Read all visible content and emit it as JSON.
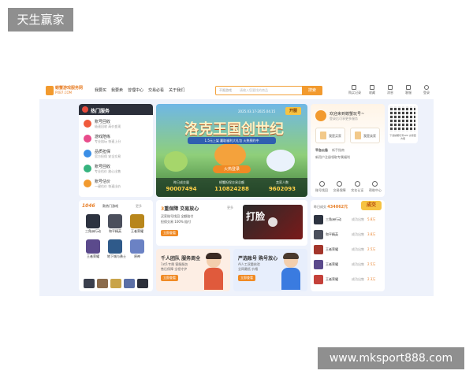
{
  "watermarks": {
    "top_left": "天生赢家",
    "bottom_right": "www.mksport888.com"
  },
  "header": {
    "logo": "螃蟹游戏服务网",
    "logo_sub": "PXB7.COM",
    "nav": [
      "我要买",
      "我要卖",
      "曾理中心",
      "交易必看",
      "关于我们"
    ],
    "search": {
      "category": "不限游戏",
      "placeholder": "请输入您要找的商品",
      "button": "搜索"
    },
    "icons": [
      {
        "name": "cart-icon",
        "label": "购买记录"
      },
      {
        "name": "star-icon",
        "label": "收藏"
      },
      {
        "name": "bell-icon",
        "label": "消息"
      },
      {
        "name": "clock-icon",
        "label": "客服"
      },
      {
        "name": "user-icon",
        "label": "登录"
      }
    ]
  },
  "hot_services": {
    "title": "热门服务",
    "items": [
      {
        "name": "账号回收",
        "desc": "极速回收 高价变现",
        "color": "#f05a3c"
      },
      {
        "name": "游戏陪练",
        "desc": "专业陪玩 快速上分",
        "color": "#e84c8b"
      },
      {
        "name": "品质担保",
        "desc": "官方担保 安全交易",
        "color": "#3a8ee6"
      },
      {
        "name": "账号回收",
        "desc": "专业估价 放心出售",
        "color": "#36b37e"
      },
      {
        "name": "账号估价",
        "desc": "一键估价 快速出价",
        "color": "#f29a2e"
      }
    ]
  },
  "banner": {
    "title": "洛克王国创世纪",
    "subtitle": "1.5元上架 赢取福利大礼包 火热预约中",
    "date": "2025.03.17-2025.04.15",
    "badge": "开服",
    "cta": "火热登录",
    "stats": [
      {
        "label": "昨日成交量",
        "value": "90007494"
      },
      {
        "label": "螃蟹担保交易总额",
        "value": "110824288"
      },
      {
        "label": "卖家人数",
        "value": "9602093"
      }
    ]
  },
  "user_panel": {
    "welcome": "欢迎来到螃蟹玩号~",
    "sub": "登录后可享更多服务",
    "buttons": [
      "我是买家",
      "我是卖家"
    ],
    "tabs": [
      "平台公告",
      "新手指南"
    ],
    "notice": "新用户注册领取专属福利",
    "quick": [
      "账号找回",
      "交易保障",
      "实名认证",
      "帮助中心"
    ]
  },
  "qr": {
    "caption": "下载螃蟹玩号APP 交易更方便"
  },
  "games": {
    "badge": "1046",
    "title": "款热门游戏",
    "more": "更多",
    "items": [
      {
        "name": "三角洲行动",
        "color": "#2d3340"
      },
      {
        "name": "和平精英",
        "color": "#4b4f5c"
      },
      {
        "name": "王者荣耀",
        "color": "#b8861b"
      },
      {
        "name": "王者荣耀",
        "color": "#5b4a8c"
      },
      {
        "name": "地下城与勇士",
        "color": "#2f5a8a"
      },
      {
        "name": "原神",
        "color": "#6b82c4"
      }
    ]
  },
  "service": {
    "title_num": "3",
    "title": "重保障 交易放心",
    "more": "更多",
    "line1": "买家账号找回 全额赔付",
    "line2": "担保交易 100% 赔付",
    "button": "立即查看",
    "thumb": "打脸"
  },
  "promos": [
    {
      "title": "千人团队 服务周全",
      "a": "1对1专属 客服服务",
      "b": "售后保障 全程守护",
      "button": "立即查看",
      "hair": "#3a2a24",
      "body": "#e05a3c",
      "bg": "#fdeee4"
    },
    {
      "title": "严选账号 购号放心",
      "a": "AI人工双重核验",
      "b": "全网最低 价格",
      "button": "立即查看",
      "hair": "#4a3a2e",
      "body": "#3a7be0",
      "bg": "#e7eefc"
    }
  ],
  "trades": {
    "label": "昨日成交",
    "amount": "434062元",
    "flag": "成交",
    "rows": [
      {
        "name": "三角洲行动",
        "status": "成功出售",
        "amount": "5.8万",
        "color": "#2d3340"
      },
      {
        "name": "和平精英",
        "status": "成功出售",
        "amount": "3.8万",
        "color": "#4b4f5c"
      },
      {
        "name": "王者荣耀",
        "status": "成功出售",
        "amount": "2.5万",
        "color": "#a3362b"
      },
      {
        "name": "王者荣耀",
        "status": "成功出售",
        "amount": "2.5万",
        "color": "#5b4a8c"
      },
      {
        "name": "王者荣耀",
        "status": "成功出售",
        "amount": "2.3万",
        "color": "#c4413a"
      }
    ]
  }
}
